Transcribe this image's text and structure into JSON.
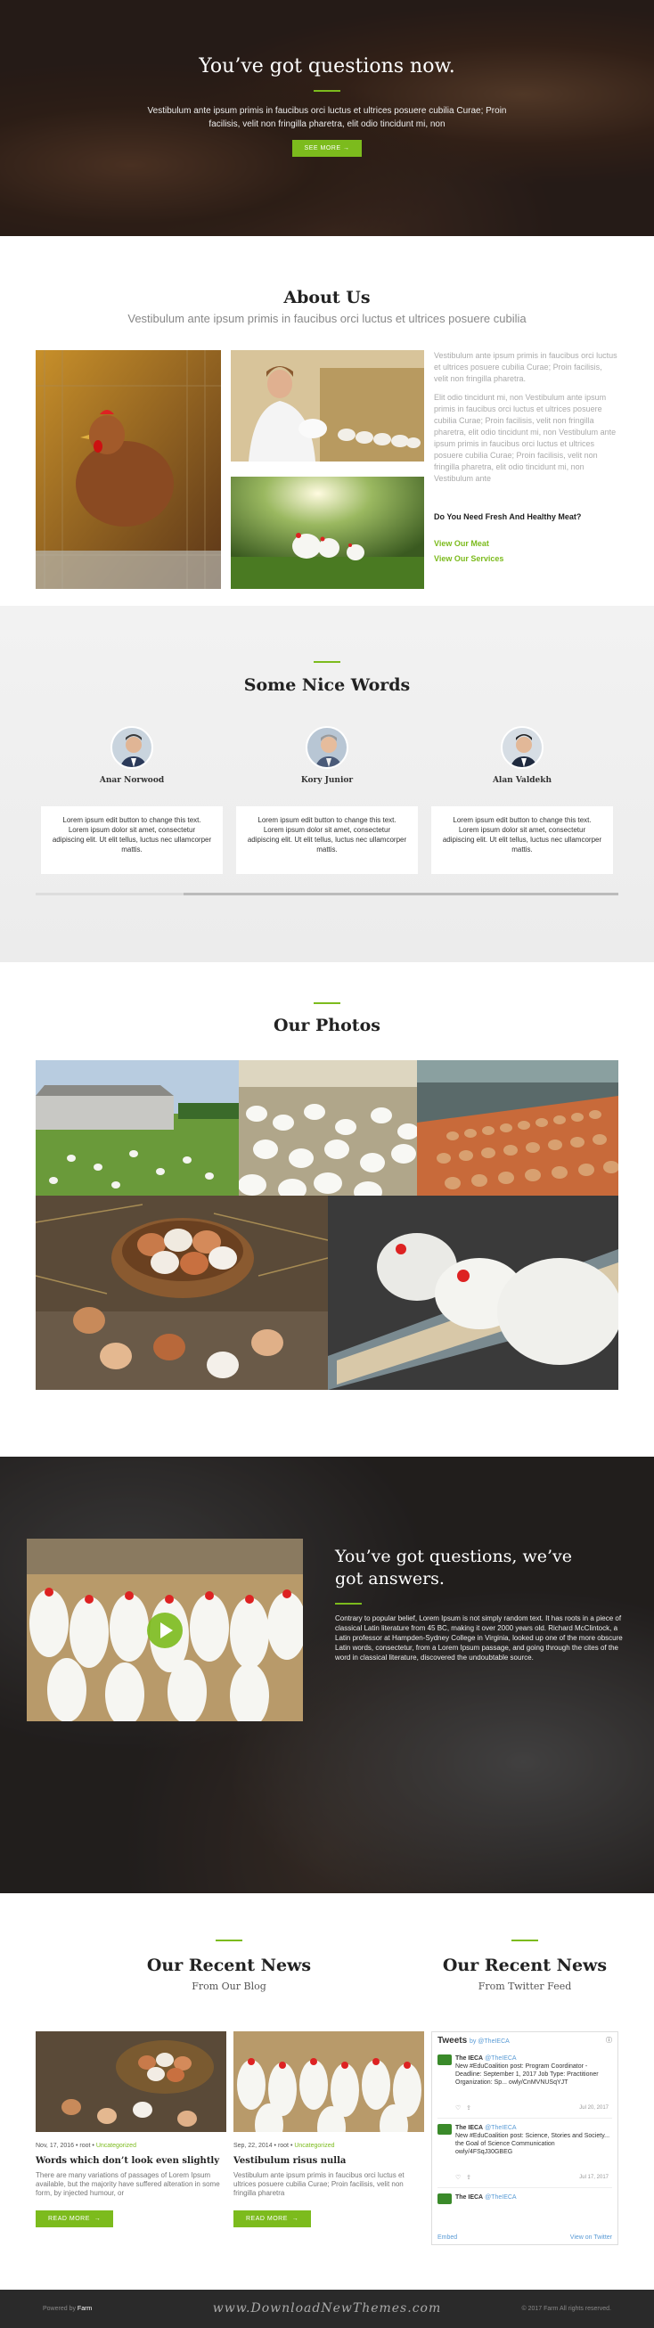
{
  "hero": {
    "title": "You’ve got questions now.",
    "text": "Vestibulum ante ipsum primis in faucibus orci luctus et ultrices posuere cubilia Curae; Proin facilisis, velit non fringilla pharetra, elit odio tincidunt mi, non",
    "button": "SEE MORE",
    "button_icon": "arrow-right-icon"
  },
  "about": {
    "title": "About Us",
    "subtitle": "Vestibulum ante ipsum primis in faucibus orci luctus et ultrices posuere cubilia",
    "para1": "Vestibulum ante ipsum primis in faucibus orci luctus et ultrices posuere cubilia Curae; Proin facilisis, velit non fringilla pharetra.",
    "para2": "Elit odio tincidunt mi, non Vestibulum ante ipsum primis in faucibus orci luctus et ultrices posuere cubilia Curae; Proin facilisis, velit non fringilla pharetra, elit odio tincidunt mi, non Vestibulum ante ipsum primis in faucibus orci luctus et ultrices posuere cubilia Curae; Proin facilisis, velit non fringilla pharetra, elit odio tincidunt mi, non Vestibulum ante",
    "question": "Do You Need Fresh And Healthy Meat?",
    "link1": "View Our Meat",
    "link2": "View Our Services"
  },
  "words": {
    "title": "Some Nice Words",
    "people": [
      {
        "name": "Anar Norwood",
        "text": "Lorem ipsum edit button to change this text. Lorem ipsum dolor sit amet, consectetur adipiscing elit. Ut elit tellus, luctus nec ullamcorper mattis."
      },
      {
        "name": "Kory Junior",
        "text": "Lorem ipsum edit button to change this text. Lorem ipsum dolor sit amet, consectetur adipiscing elit. Ut elit tellus, luctus nec ullamcorper mattis."
      },
      {
        "name": "Alan Valdekh",
        "text": "Lorem ipsum edit button to change this text. Lorem ipsum dolor sit amet, consectetur adipiscing elit. Ut elit tellus, luctus nec ullamcorper mattis."
      }
    ]
  },
  "photos": {
    "title": "Our Photos"
  },
  "video": {
    "title": "You’ve got questions, we’ve got answers.",
    "text": "Contrary to popular belief, Lorem Ipsum is not simply random text. It has roots in a piece of classical Latin literature from 45 BC, making it over 2000 years old. Richard McClintock, a Latin professor at Hampden-Sydney College in Virginia, looked up one of the more obscure Latin words, consectetur, from a Lorem Ipsum passage, and going through the cites of the word in classical literature, discovered the undoubtable source."
  },
  "news": {
    "title": "Our Recent News",
    "subtitle": "From Our Blog",
    "feed_title": "Our Recent News",
    "feed_subtitle": "From Twitter Feed",
    "posts": [
      {
        "date": "Nov, 17, 2016",
        "author": "root",
        "category": "Uncategorized",
        "title": "Words which don’t look even slightly",
        "excerpt": "There are many variations of passages of Lorem Ipsum available, but the majority have suffered alteration in some form, by injected humour, or",
        "button": "READ MORE"
      },
      {
        "date": "Sep, 22, 2014",
        "author": "root",
        "category": "Uncategorized",
        "title": "Vestibulum risus nulla",
        "excerpt": "Vestibulum ante ipsum primis in faucibus orci luctus et ultrices posuere cubilia Curae; Proin facilisis, velit non fringilla pharetra",
        "button": "READ MORE"
      }
    ],
    "twitter": {
      "header": "Tweets",
      "by": "by @TheIECA",
      "tweets": [
        {
          "name": "The IECA",
          "handle": "@TheIECA",
          "text": "New #EduCoalition post: Program Coordinator - Deadline: September 1, 2017 Job Type: Practitioner Organization: Sp... owly/CnMVNUSqYJT",
          "date": "Jul 20, 2017"
        },
        {
          "name": "The IECA",
          "handle": "@TheIECA",
          "text": "New #EduCoalition post: Science, Stories and Society... the Goal of Science Communication owly/4FSqJ30GBEG",
          "date": "Jul 17, 2017"
        },
        {
          "name": "The IECA",
          "handle": "@TheIECA",
          "text": "",
          "date": ""
        }
      ],
      "embed": "Embed",
      "view": "View on Twitter"
    }
  },
  "footer": {
    "powered": "Powered by",
    "brand": "Farm",
    "watermark": "www.DownloadNewThemes.com",
    "copyright": "© 2017 Farm All rights reserved."
  }
}
